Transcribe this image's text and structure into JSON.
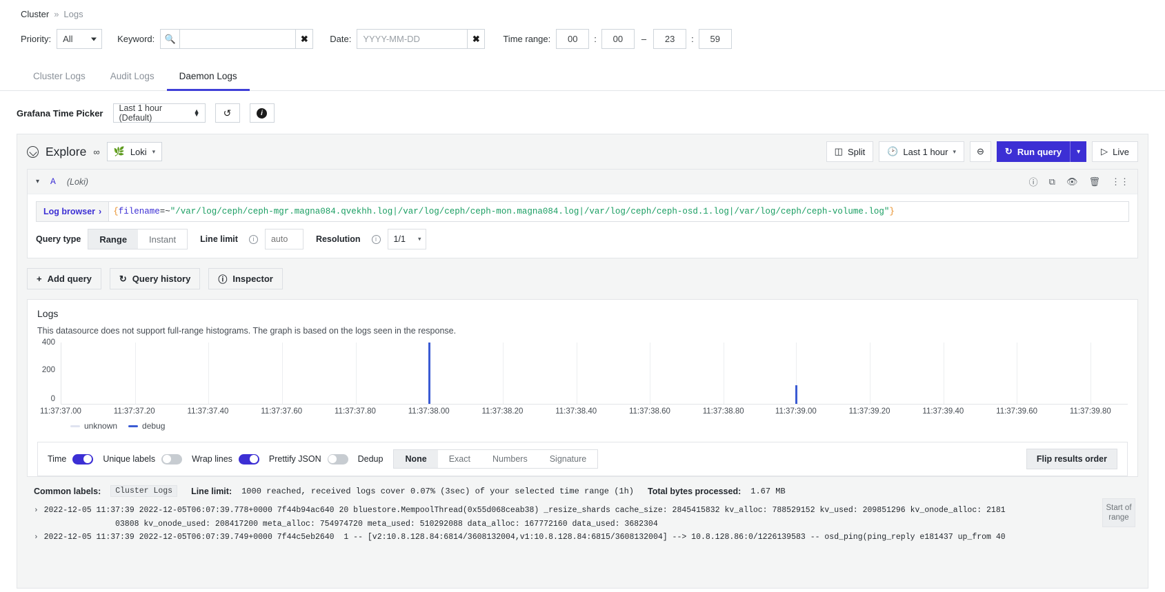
{
  "breadcrumb": {
    "root": "Cluster",
    "separator": "»",
    "current": "Logs"
  },
  "filters": {
    "priority_label": "Priority:",
    "priority_value": "All",
    "keyword_label": "Keyword:",
    "keyword_value": "",
    "keyword_placeholder": "",
    "search_icon": "search-icon",
    "keyword_clear": "✖",
    "date_label": "Date:",
    "date_value": "",
    "date_placeholder": "YYYY-MM-DD",
    "date_clear": "✖",
    "timerange_label": "Time range:",
    "from_hour": "00",
    "from_minute": "00",
    "to_hour": "23",
    "to_minute": "59",
    "colon": ":",
    "dash": "–"
  },
  "tabs": [
    {
      "label": "Cluster Logs",
      "active": false
    },
    {
      "label": "Audit Logs",
      "active": false
    },
    {
      "label": "Daemon Logs",
      "active": true
    }
  ],
  "grafana_picker": {
    "label": "Grafana Time Picker",
    "value": "Last 1 hour (Default)",
    "refresh_icon": "↺",
    "info_icon": "i"
  },
  "explore": {
    "title": "Explore",
    "compass_icon": "compass-icon",
    "share_icon": "share-icon",
    "datasource": "Loki",
    "datasource_icon": "loki-icon",
    "split_label": "Split",
    "time_label": "Last 1 hour",
    "zoom_out_icon": "zoom-out-icon",
    "run_label": "Run query",
    "run_icon": "refresh-icon",
    "live_label": "Live",
    "live_icon": "play-icon"
  },
  "query": {
    "letter": "A",
    "datasource_note": "(Loki)",
    "log_browser": "Log browser",
    "log_browser_chevron": "›",
    "expression_tokens": [
      {
        "t": "{",
        "k": "brace"
      },
      {
        "t": "filename",
        "k": "label"
      },
      {
        "t": "=~",
        "k": "op"
      },
      {
        "t": "\"/var/log/ceph/ceph-mgr.magna084.qvekhh.log|/var/log/ceph/ceph-mon.magna084.log|/var/log/ceph/ceph-osd.1.log|/var/log/ceph/ceph-volume.log\"",
        "k": "str"
      },
      {
        "t": "}",
        "k": "brace"
      }
    ],
    "expression_plain": "{filename=~\"/var/log/ceph/ceph-mgr.magna084.qvekhh.log|/var/log/ceph/ceph-mon.magna084.log|/var/log/ceph/ceph-osd.1.log|/var/log/ceph/ceph-volume.log\"}",
    "query_type_label": "Query type",
    "query_type_options": [
      "Range",
      "Instant"
    ],
    "query_type_selected": "Range",
    "line_limit_label": "Line limit",
    "line_limit_value": "",
    "line_limit_placeholder": "auto",
    "resolution_label": "Resolution",
    "resolution_value": "1/1",
    "add_query": "Add query",
    "query_history": "Query history",
    "inspector": "Inspector",
    "header_icons": [
      "help-icon",
      "copy-icon",
      "eye-icon",
      "trash-icon",
      "drag-handle-icon"
    ]
  },
  "logs_panel": {
    "title": "Logs",
    "note": "This datasource does not support full-range histograms. The graph is based on the logs seen in the response.",
    "options": {
      "time_label": "Time",
      "time_on": true,
      "unique_labels_label": "Unique labels",
      "unique_labels_on": false,
      "wrap_lines_label": "Wrap lines",
      "wrap_lines_on": true,
      "prettify_label": "Prettify JSON",
      "prettify_on": false,
      "dedup_label": "Dedup",
      "dedup_options": [
        "None",
        "Exact",
        "Numbers",
        "Signature"
      ],
      "dedup_selected": "None",
      "flip_label": "Flip results order"
    }
  },
  "chart_data": {
    "type": "bar",
    "title": "Logs",
    "xlabel": "",
    "ylabel": "",
    "ylim": [
      0,
      400
    ],
    "yticks": [
      0,
      200,
      400
    ],
    "grid": true,
    "legend_position": "bottom",
    "x_tick_labels": [
      "11:37:37.00",
      "11:37:37.20",
      "11:37:37.40",
      "11:37:37.60",
      "11:37:37.80",
      "11:37:38.00",
      "11:37:38.20",
      "11:37:38.40",
      "11:37:38.60",
      "11:37:38.80",
      "11:37:39.00",
      "11:37:39.20",
      "11:37:39.40",
      "11:37:39.60",
      "11:37:39.80"
    ],
    "series": [
      {
        "name": "unknown",
        "color": "#dfe3f0",
        "values": [
          0,
          0,
          0,
          0,
          0,
          0,
          0,
          0,
          0,
          0,
          0,
          0,
          0,
          0,
          0
        ]
      },
      {
        "name": "debug",
        "color": "#3b5bd3",
        "values": [
          0,
          0,
          0,
          0,
          0,
          440,
          0,
          0,
          0,
          0,
          130,
          0,
          0,
          0,
          0
        ]
      }
    ],
    "bars": [
      {
        "x_pct": 34.5,
        "height_pct": 100,
        "series": "debug"
      },
      {
        "x_pct": 68.5,
        "height_pct": 30,
        "series": "debug"
      }
    ]
  },
  "meta": {
    "common_labels_label": "Common labels:",
    "common_labels_value": "Cluster Logs",
    "line_limit_text": "Line limit:",
    "line_limit_detail": "1000 reached, received logs cover 0.07% (3sec) of your selected time range (1h)",
    "bytes_label": "Total bytes processed:",
    "bytes_value": "1.67 MB"
  },
  "log_entries": [
    {
      "caret": "›",
      "line1": "2022-12-05 11:37:39 2022-12-05T06:07:39.778+0000 7f44b94ac640 20 bluestore.MempoolThread(0x55d068ceab38) _resize_shards cache_size: 2845415832 kv_alloc: 788529152 kv_used: 209851296 kv_onode_alloc: 2181",
      "line2": "03808 kv_onode_used: 208417200 meta_alloc: 754974720 meta_used: 510292088 data_alloc: 167772160 data_used: 3682304"
    },
    {
      "caret": "›",
      "line1": "2022-12-05 11:37:39 2022-12-05T06:07:39.749+0000 7f44c5eb2640  1 -- [v2:10.8.128.84:6814/3608132004,v1:10.8.128.84:6815/3608132004] --> 10.8.128.86:0/1226139583 -- osd_ping(ping_reply e181437 up_from 40",
      "line2": ""
    }
  ],
  "start_of_range": "Start of range",
  "colors": {
    "accent": "#3c2fd4",
    "tab_active": "#3f3fd8",
    "series_debug": "#3b5bd3",
    "series_unknown": "#dfe3f0"
  }
}
